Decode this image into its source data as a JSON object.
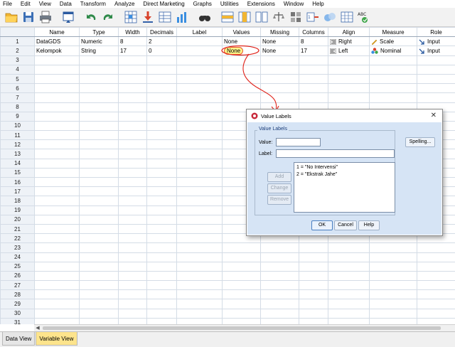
{
  "menu": [
    "File",
    "Edit",
    "View",
    "Data",
    "Transform",
    "Analyze",
    "Direct Marketing",
    "Graphs",
    "Utilities",
    "Extensions",
    "Window",
    "Help"
  ],
  "toolbar_icons": [
    "open-folder-icon",
    "save-icon",
    "print-icon",
    "dialog-recall-icon",
    "undo-icon",
    "redo-icon",
    "goto-case-icon",
    "goto-variable-icon",
    "variables-icon",
    "run-descriptive-icon",
    "find-icon",
    "insert-cases-icon",
    "insert-variable-icon",
    "split-file-icon",
    "weight-cases-icon",
    "select-cases-icon",
    "value-labels-icon",
    "use-sets-icon",
    "show-all-variables-icon",
    "spelling-icon"
  ],
  "grid": {
    "columns": [
      "Name",
      "Type",
      "Width",
      "Decimals",
      "Label",
      "Values",
      "Missing",
      "Columns",
      "Align",
      "Measure",
      "Role"
    ],
    "rows": [
      {
        "num": "1",
        "name": "DataGDS",
        "type": "Numeric",
        "width": "8",
        "decimals": "2",
        "label": "",
        "values": "None",
        "missing": "None",
        "columns": "8",
        "align": "Right",
        "measure": "Scale",
        "role": "Input"
      },
      {
        "num": "2",
        "name": "Kelompok",
        "type": "String",
        "width": "17",
        "decimals": "0",
        "label": "",
        "values": "None",
        "missing": "None",
        "columns": "17",
        "align": "Left",
        "measure": "Nominal",
        "role": "Input"
      }
    ],
    "empty_row_numbers": [
      "3",
      "4",
      "5",
      "6",
      "7",
      "8",
      "9",
      "10",
      "11",
      "12",
      "13",
      "14",
      "15",
      "16",
      "17",
      "18",
      "19",
      "20",
      "21",
      "22",
      "23",
      "24",
      "25",
      "26",
      "27",
      "28",
      "29",
      "30",
      "31"
    ]
  },
  "tabs": {
    "data_view": "Data View",
    "variable_view": "Variable View"
  },
  "dialog": {
    "title": "Value Labels",
    "group_title": "Value Labels",
    "value_label": "Value:",
    "label_label": "Label:",
    "list_items": [
      "1 = \"No Intervensi\"",
      "2 = \"Ekstrak Jahe\""
    ],
    "add": "Add",
    "change": "Change",
    "remove": "Remove",
    "spelling": "Spelling...",
    "ok": "OK",
    "cancel": "Cancel",
    "help": "Help"
  },
  "colors": {
    "active_tab": "#fde48c",
    "dialog_bg": "#d6e4f5",
    "annotation": "#e0231a",
    "highlight": "#fff48a"
  }
}
